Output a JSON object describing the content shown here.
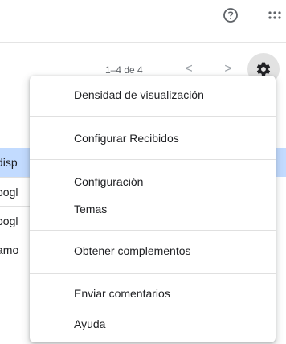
{
  "header": {
    "help_icon": "help-circle-icon",
    "apps_icon": "apps-grid-icon"
  },
  "toolbar": {
    "range_text": "1–4 de 4",
    "prev_label": "<",
    "next_label": ">",
    "settings_icon": "gear-icon"
  },
  "list": {
    "rows": [
      {
        "sender": "disp",
        "selected": true
      },
      {
        "sender": "oogl",
        "selected": false
      },
      {
        "sender": "oogl",
        "selected": false
      },
      {
        "sender": "amo",
        "selected": false
      }
    ]
  },
  "menu": {
    "items": [
      {
        "label": "Densidad de visualización"
      },
      {
        "label": "Configurar Recibidos"
      },
      {
        "label": "Configuración"
      },
      {
        "label": "Temas"
      },
      {
        "label": "Obtener complementos"
      },
      {
        "label": "Enviar comentarios"
      },
      {
        "label": "Ayuda"
      }
    ]
  },
  "colors": {
    "selected_row": "#c2dbff",
    "menu_background": "#ffffff",
    "gear_bg": "#e2e2e2"
  }
}
